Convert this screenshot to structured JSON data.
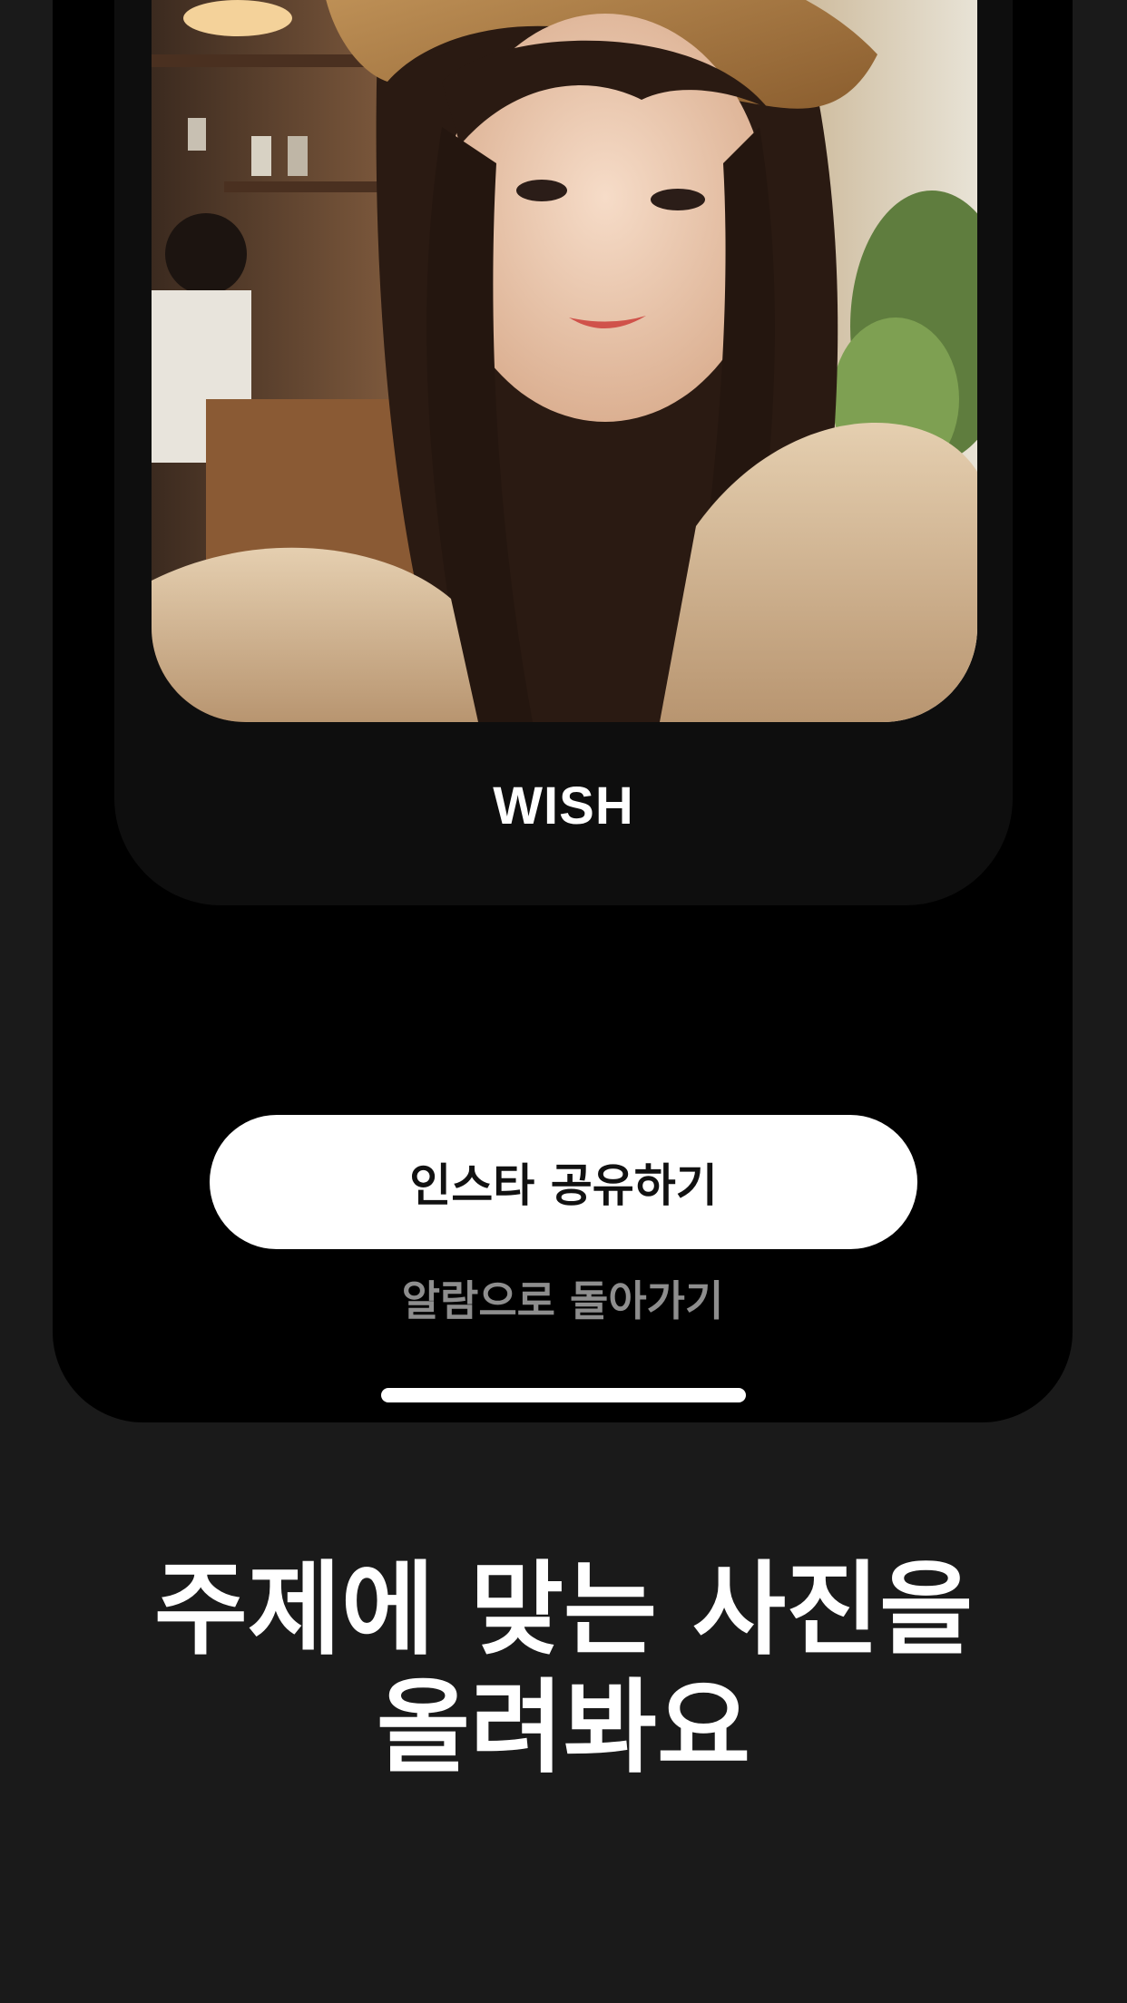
{
  "post": {
    "title": "WISH",
    "photo_description_icon": "photo-image"
  },
  "actions": {
    "share_label": "인스타 공유하기",
    "back_label": "알람으로 돌아가기"
  },
  "headline": {
    "line1": "주제에 맞는 사진을",
    "line2": "올려봐요"
  },
  "colors": {
    "background": "#1a1a1a",
    "phone": "#000000",
    "card": "#0e0e0e",
    "button": "#ffffff",
    "secondary_text": "#8e8e8e"
  }
}
